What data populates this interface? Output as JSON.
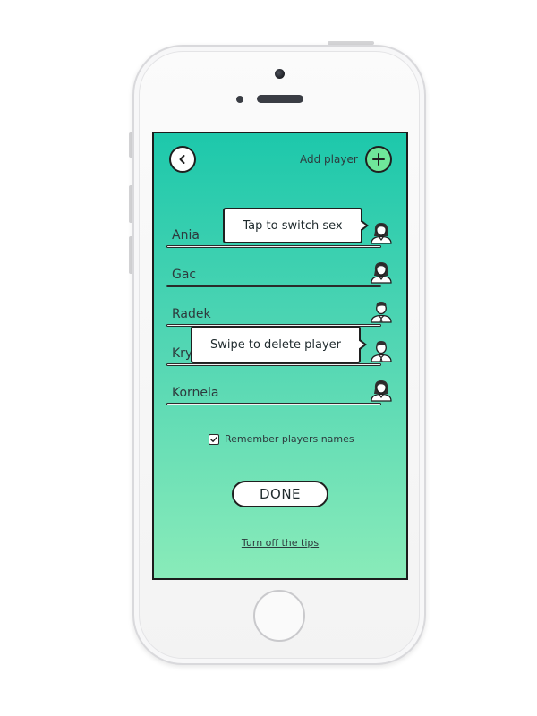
{
  "header": {
    "back_icon": "chevron-left-icon",
    "add_player_label": "Add player",
    "add_icon": "plus-icon"
  },
  "players": [
    {
      "name": "Ania",
      "sex": "female"
    },
    {
      "name": "Gac",
      "sex": "female"
    },
    {
      "name": "Radek",
      "sex": "male"
    },
    {
      "name": "Kry",
      "sex": "male"
    },
    {
      "name": "Kornela",
      "sex": "female"
    }
  ],
  "tips": {
    "switch_sex": "Tap to switch sex",
    "delete_player": "Swipe to delete player"
  },
  "remember": {
    "label": "Remember players names",
    "checked": true
  },
  "done_label": "DONE",
  "tips_link": "Turn off the tips",
  "colors": {
    "gradient_top": "#1dc8ab",
    "gradient_bottom": "#89ebb9",
    "add_button": "#6fe69a"
  }
}
